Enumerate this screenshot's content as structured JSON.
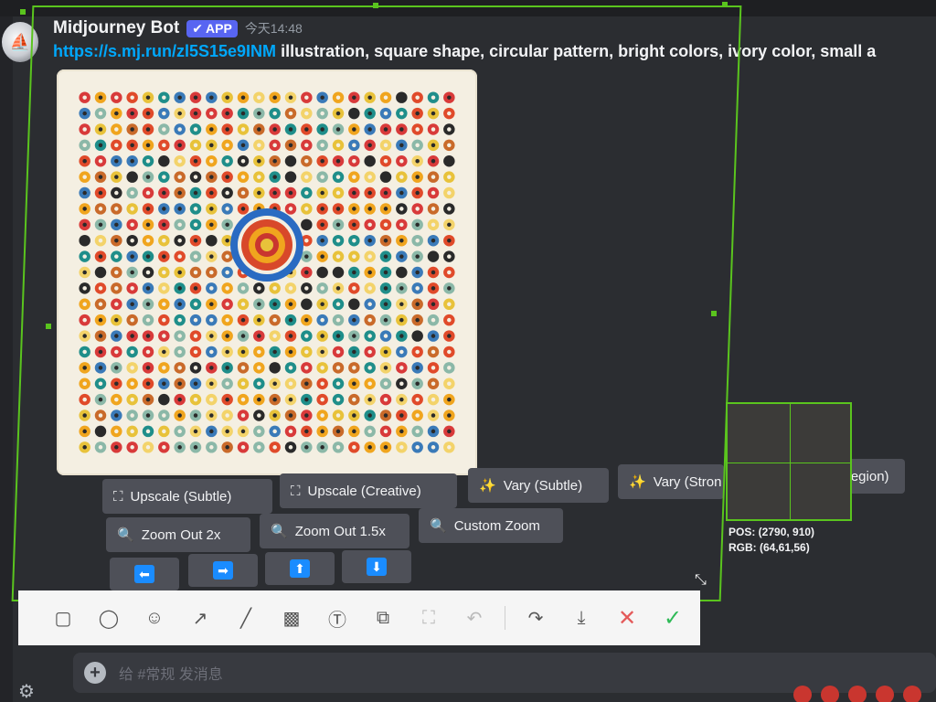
{
  "message": {
    "username": "Midjourney Bot",
    "badge": "APP",
    "timestamp": "今天14:48",
    "prompt_link": "https://s.mj.run/zl5S15e9INM",
    "prompt_text": " illustration, square shape, circular pattern, bright colors, ivory color, small a"
  },
  "buttons": {
    "upscale_subtle": "Upscale (Subtle)",
    "upscale_creative": "Upscale (Creative)",
    "vary_subtle": "Vary (Subtle)",
    "vary_strong": "Vary (Stron",
    "vary_region": "Region)",
    "zoom_out_2x": "Zoom Out 2x",
    "zoom_out_15x": "Zoom Out 1.5x",
    "custom_zoom": "Custom Zoom"
  },
  "magnifier": {
    "pos": "POS:  (2790, 910)",
    "rgb": "RGB:  (64,61,56)"
  },
  "chat": {
    "placeholder": "给 #常规 发消息"
  },
  "colors": {
    "selection": "#5ac41e",
    "accent": "#5865f2",
    "link": "#00a8fc",
    "button": "#4e5058",
    "arrow": "#1a8cff"
  }
}
